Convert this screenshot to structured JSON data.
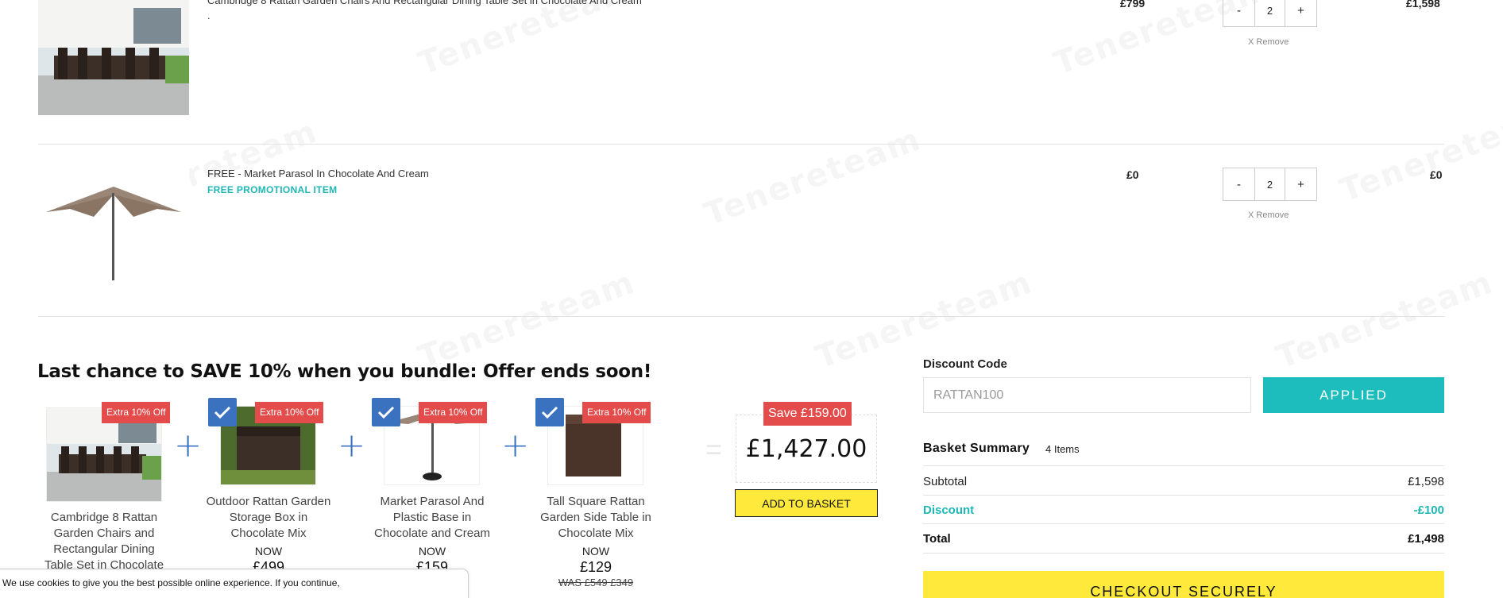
{
  "cart": {
    "items": [
      {
        "name": "Cambridge 8 Rattan Garden Chairs And Rectangular Dining Table Set in Chocolate And Cream",
        "name_suffix": ".",
        "price": "£799",
        "quantity": "2",
        "line_total": "£1,598",
        "remove_label": "X Remove"
      },
      {
        "name": "FREE - Market Parasol In Chocolate And Cream",
        "promo_label": "FREE PROMOTIONAL ITEM",
        "price": "£0",
        "quantity": "2",
        "line_total": "£0",
        "remove_label": "X Remove"
      }
    ],
    "qty_minus": "-",
    "qty_plus": "+"
  },
  "bundle": {
    "title": "Last chance to SAVE 10% when you bundle: Offer ends soon!",
    "badge": "Extra 10% Off",
    "items": [
      {
        "name": "Cambridge 8 Rattan Garden Chairs and Rectangular Dining Table Set in Chocolate",
        "now": "",
        "price": "",
        "was": ""
      },
      {
        "name": "Outdoor Rattan Garden Storage Box in Chocolate Mix",
        "now": "NOW",
        "price": "£499",
        "was": ""
      },
      {
        "name": "Market Parasol And Plastic Base in Chocolate and Cream",
        "now": "NOW",
        "price": "£159",
        "was": ""
      },
      {
        "name": "Tall Square Rattan Garden Side Table in Chocolate Mix",
        "now": "NOW",
        "price": "£129",
        "was": "WAS £549 £349"
      }
    ],
    "plus": "+",
    "equals": "=",
    "save_label": "Save £159.00",
    "total": "£1,427.00",
    "add_button": "ADD TO BASKET"
  },
  "discount": {
    "label": "Discount Code",
    "placeholder": "RATTAN100",
    "button": "APPLIED"
  },
  "summary": {
    "title": "Basket Summary",
    "count": "4 Items",
    "rows": [
      {
        "label": "Subtotal",
        "value": "£1,598"
      },
      {
        "label": "Discount",
        "value": "-£100"
      },
      {
        "label": "Total",
        "value": "£1,498"
      }
    ],
    "checkout": "CHECKOUT SECURELY"
  },
  "cookie": {
    "text": "We use cookies to give you the best possible online experience. If you continue,"
  },
  "watermark": "Tenereteam",
  "colors": {
    "teal": "#1dbdbd",
    "yellow": "#ffe93b",
    "badge_red": "#e44b4b",
    "check_blue": "#3b72c0"
  }
}
